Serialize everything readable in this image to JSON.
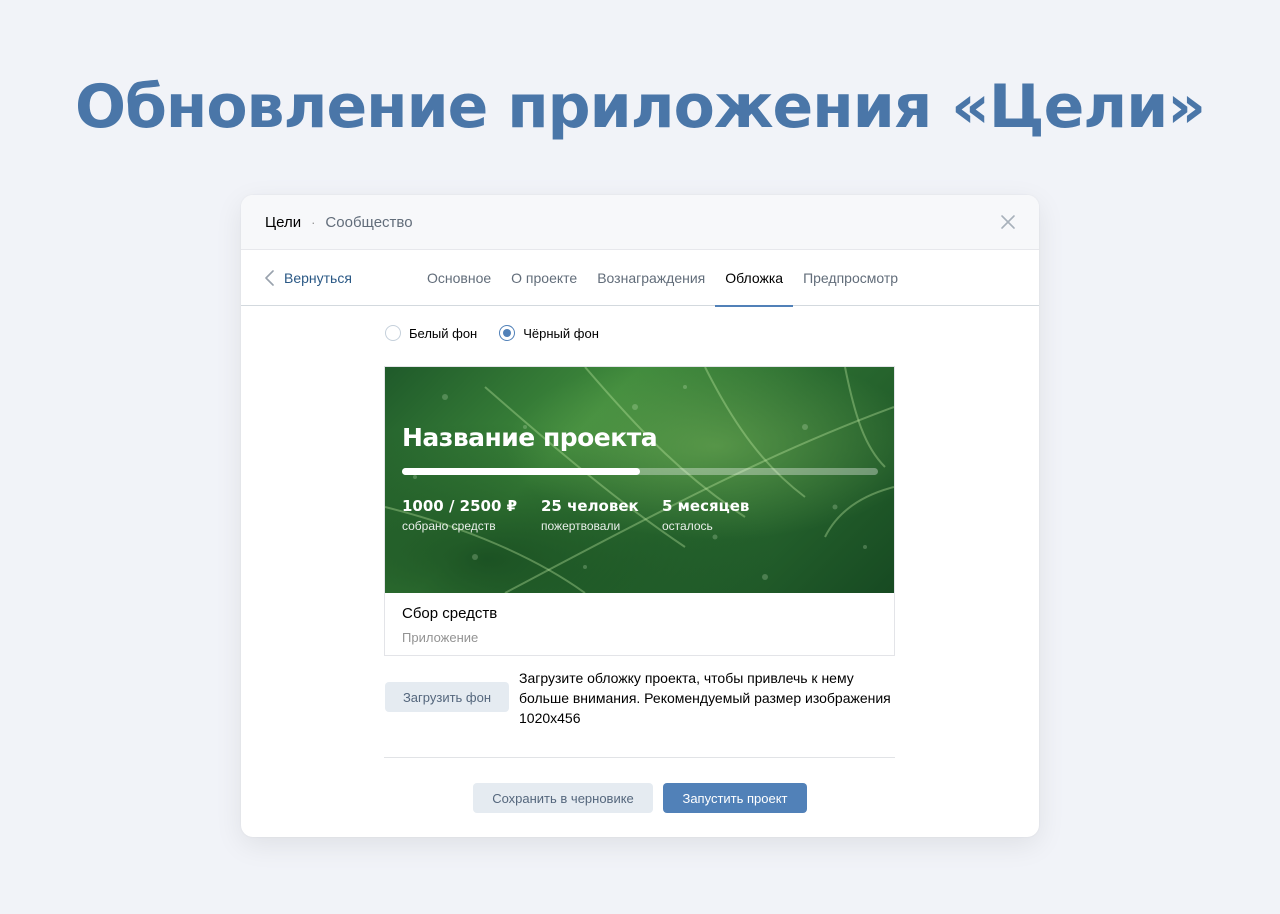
{
  "headline": "Обновление приложения «Цели»",
  "header": {
    "app_name": "Цели",
    "separator": "·",
    "section": "Сообщество",
    "close_icon": "close-icon"
  },
  "nav": {
    "back_label": "Вернуться",
    "tabs": [
      {
        "label": "Основное",
        "active": false
      },
      {
        "label": "О проекте",
        "active": false
      },
      {
        "label": "Вознаграждения",
        "active": false
      },
      {
        "label": "Обложка",
        "active": true
      },
      {
        "label": "Предпросмотр",
        "active": false
      }
    ]
  },
  "background_options": [
    {
      "label": "Белый фон",
      "checked": false
    },
    {
      "label": "Чёрный фон",
      "checked": true
    }
  ],
  "cover": {
    "title": "Название проекта",
    "progress_fraction": 0.5,
    "stats": [
      {
        "value": "1000 / 2500 ₽",
        "label": "собрано средств"
      },
      {
        "value": "25 человек",
        "label": "пожертвовали"
      },
      {
        "value": "5 месяцев",
        "label": "осталось"
      }
    ]
  },
  "card": {
    "title": "Сбор средств",
    "subtitle": "Приложение"
  },
  "upload": {
    "button_label": "Загрузить фон",
    "hint": "Загрузите обложку проекта, чтобы привлечь к нему больше внимания. Рекомендуемый размер изображения 1020x456"
  },
  "footer": {
    "save_draft_label": "Сохранить в черновике",
    "launch_label": "Запустить проект"
  },
  "colors": {
    "accent": "#5181b8",
    "headline": "#4a76a8",
    "link": "#2a5885",
    "background": "#f1f3f8"
  }
}
